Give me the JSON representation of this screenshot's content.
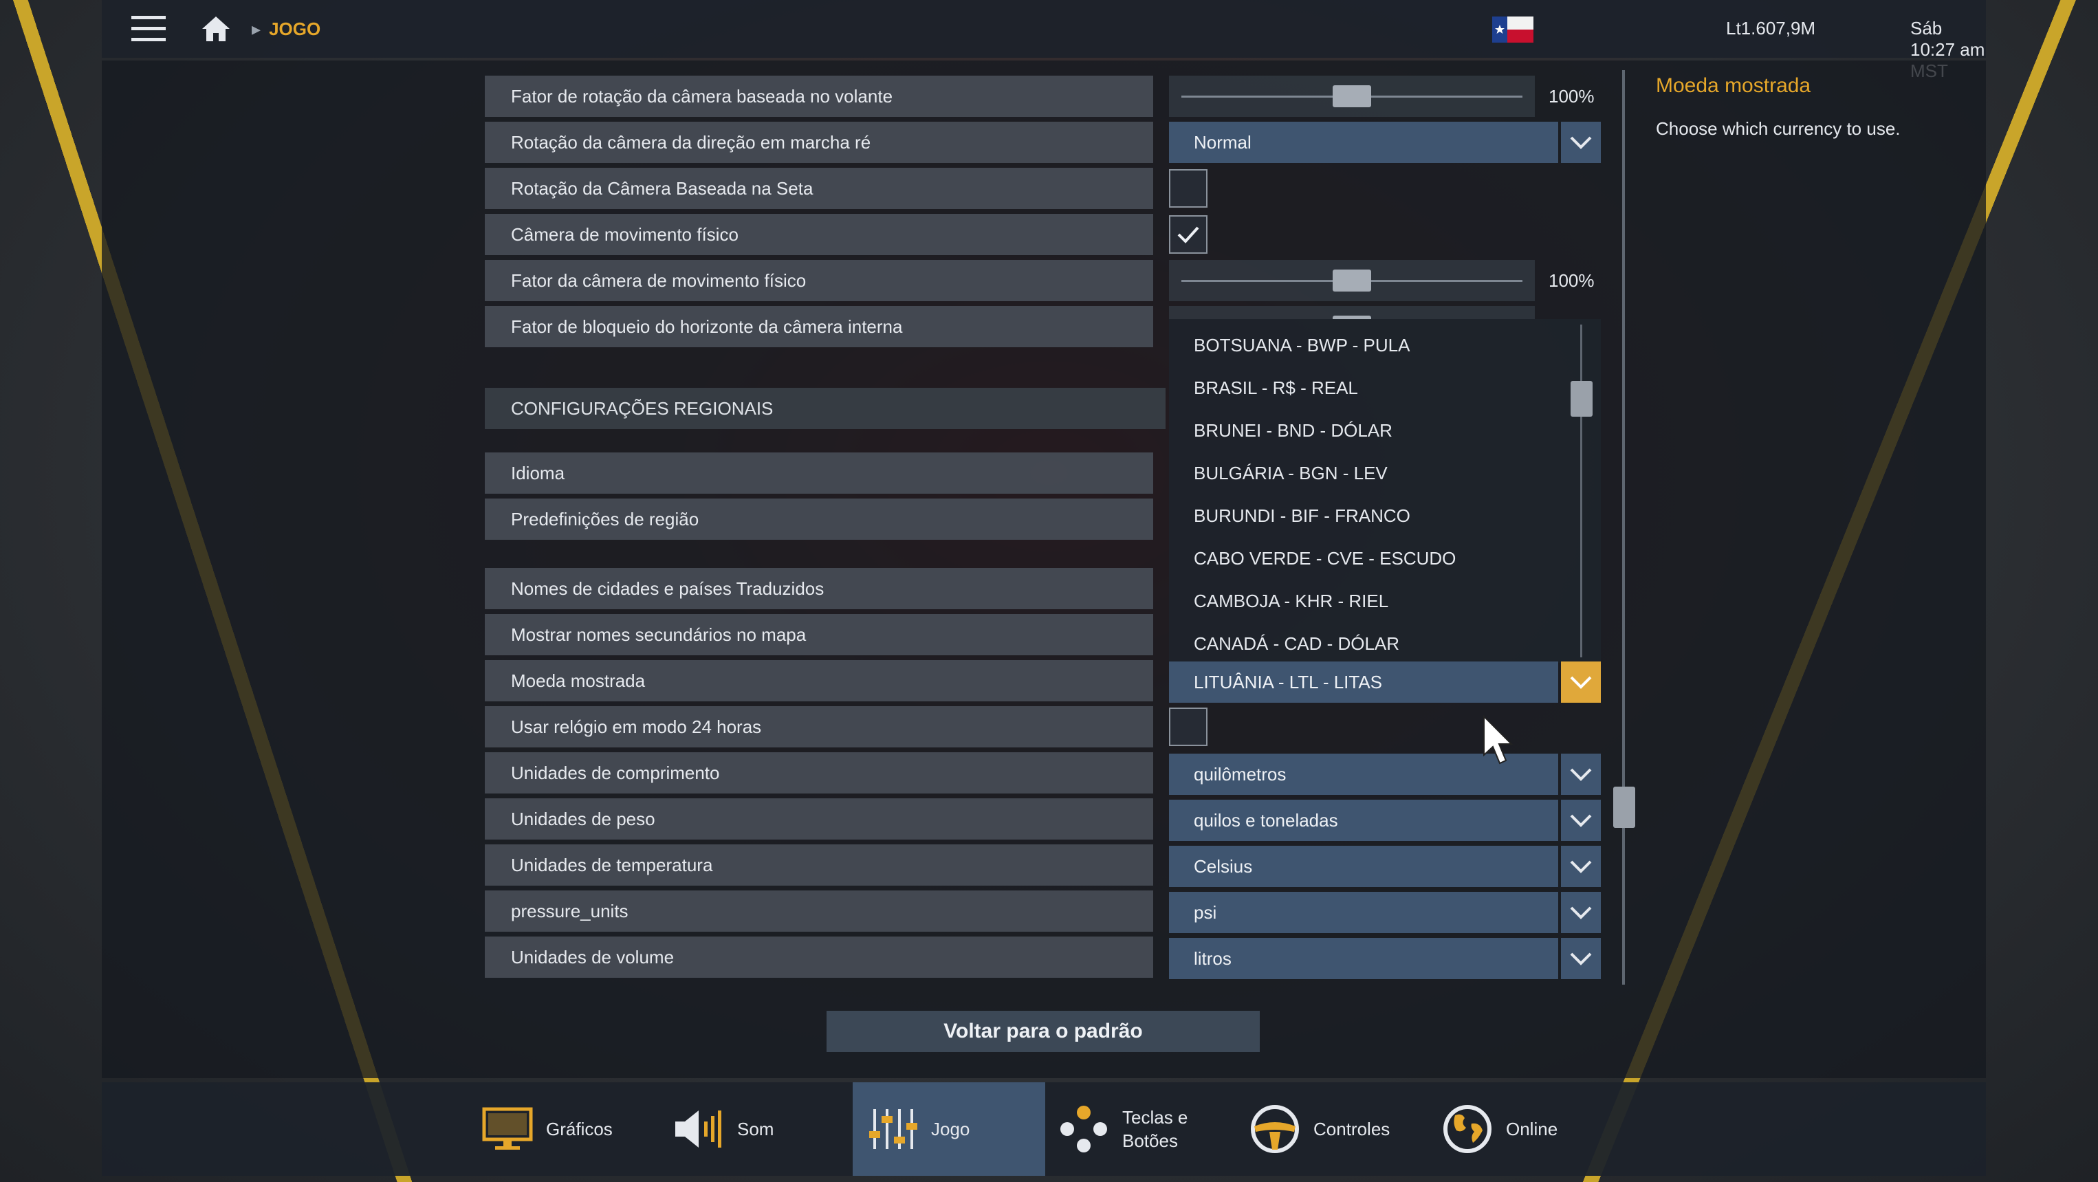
{
  "topbar": {
    "breadcrumb": "JOGO",
    "money": "Lt1.607,9M",
    "clock": "Sáb 10:27 am MST"
  },
  "rows": [
    {
      "label": "Fator de rotação da câmera baseada no volante",
      "control": "slider",
      "value_text": "100%",
      "level": 0.5
    },
    {
      "label": "Rotação da câmera da direção em marcha ré",
      "control": "select",
      "value_text": "Normal"
    },
    {
      "label": "Rotação da Câmera Baseada na Seta",
      "control": "checkbox",
      "checked": false
    },
    {
      "label": "Câmera de movimento físico",
      "control": "checkbox",
      "checked": true
    },
    {
      "label": "Fator da câmera de movimento físico",
      "control": "slider",
      "value_text": "100%",
      "level": 0.5
    },
    {
      "label": "Fator de bloqueio do horizonte da câmera interna",
      "control": "slider-partial"
    }
  ],
  "section_regional": "CONFIGURAÇÕES REGIONAIS",
  "regional_rows": [
    {
      "label": "Idioma"
    },
    {
      "label": "Predefinições de região"
    }
  ],
  "rows2": [
    {
      "label": "Nomes de cidades e países Traduzidos"
    },
    {
      "label": "Mostrar nomes secundários no mapa"
    },
    {
      "label": "Moeda mostrada",
      "control": "select-open",
      "value_text": "LITUÂNIA - LTL - LITAS"
    },
    {
      "label": "Usar relógio em modo 24 horas",
      "control": "checkbox",
      "checked": false
    },
    {
      "label": "Unidades de comprimento",
      "control": "select",
      "value_text": "quilômetros"
    },
    {
      "label": "Unidades de peso",
      "control": "select",
      "value_text": "quilos e toneladas"
    },
    {
      "label": "Unidades de temperatura",
      "control": "select",
      "value_text": "Celsius"
    },
    {
      "label": "pressure_units",
      "control": "select",
      "value_text": "psi"
    },
    {
      "label": "Unidades de volume",
      "control": "select",
      "value_text": "litros"
    }
  ],
  "currency_dropdown": {
    "options": [
      "BOTSUANA - BWP - PULA",
      "BRASIL - R$ - REAL",
      "BRUNEI - BND - DÓLAR",
      "BULGÁRIA - BGN - LEV",
      "BURUNDI - BIF - FRANCO",
      "CABO VERDE - CVE - ESCUDO",
      "CAMBOJA - KHR - RIEL",
      "CANADÁ - CAD - DÓLAR"
    ]
  },
  "help": {
    "title": "Moeda mostrada",
    "text": "Choose which currency to use."
  },
  "reset_label": "Voltar para o padrão",
  "tabs": [
    {
      "label": "Gráficos",
      "icon": "monitor-icon"
    },
    {
      "label": "Som",
      "icon": "speaker-icon"
    },
    {
      "label": "Jogo",
      "icon": "sliders-icon",
      "active": true
    },
    {
      "label": "Teclas e Botões",
      "icon": "gamepad-icon"
    },
    {
      "label": "Controles",
      "icon": "steering-wheel-icon"
    },
    {
      "label": "Online",
      "icon": "globe-icon"
    }
  ],
  "colors": {
    "accent": "#e6a72a",
    "select_bg": "#3f5570",
    "active_arrow": "#e0a83a"
  }
}
